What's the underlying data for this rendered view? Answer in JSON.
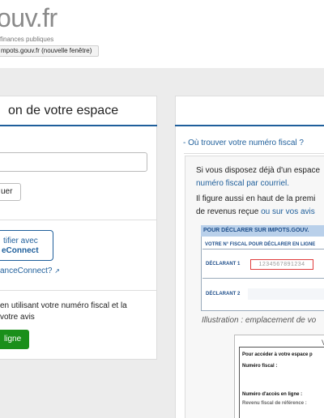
{
  "header": {
    "logo": "ouv.fr",
    "subtitle": "finances publiques",
    "tooltip": "mpots.gouv.fr (nouvelle fenêtre)"
  },
  "left": {
    "title": "on de votre espace",
    "continue_label": "uer",
    "franceconnect": {
      "line1": "tifier avec",
      "line2": "eConnect",
      "link": "anceConnect?"
    },
    "fiscal_text": "en utilisant votre numéro fiscal et la votre avis",
    "button": "ligne"
  },
  "right": {
    "accordion": "- Où trouver votre numéro fiscal ?",
    "p1a": "Si vous disposez déjà d'un espace",
    "p1b": "numéro fiscal par courriel.",
    "p2a": "Il figure aussi en haut de la premi",
    "p2b": "de revenus reçue",
    "p2b_link": "ou sur vos avis",
    "doc": {
      "header": "POUR DÉCLARER SUR IMPOTS.GOUV.",
      "subheader": "VOTRE N° FISCAL POUR DÉCLARER EN LIGNE",
      "declarant1": "DÉCLARANT 1",
      "number": "1234567891234",
      "declarant2": "DÉCLARANT 2"
    },
    "caption": "Illustration : emplacement de vo",
    "doc2": {
      "letter": "V",
      "line1": "Pour accéder à votre espace p",
      "line2": "Numéro fiscal :",
      "line3": "Numéro d'accès en ligne :",
      "line4": "Revenu fiscal de référence :"
    }
  },
  "colors": {
    "accent": "#1f5f9b",
    "green": "#1a8f1a",
    "highlight_border": "#e03c3c"
  }
}
